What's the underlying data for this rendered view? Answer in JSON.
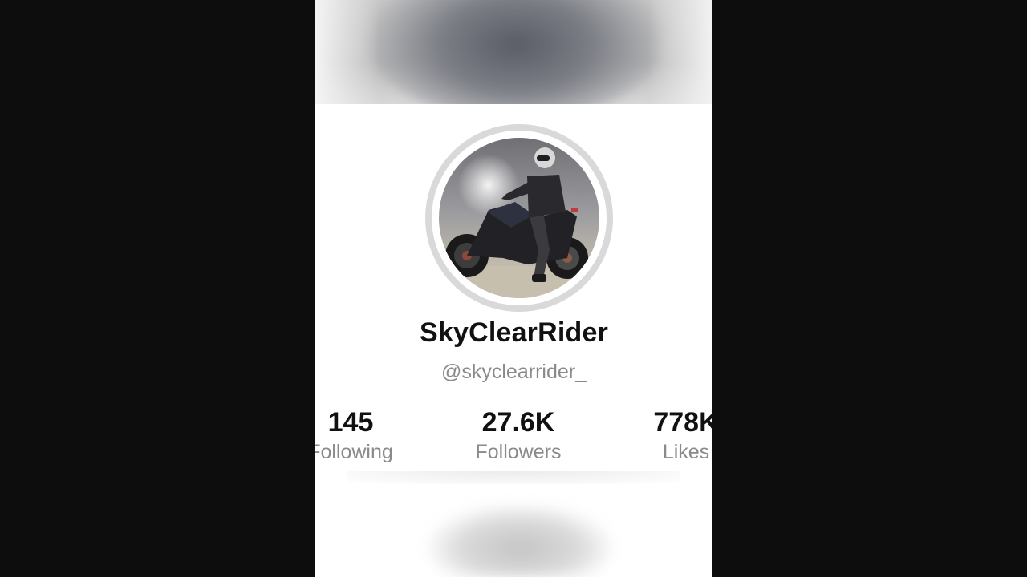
{
  "profile": {
    "display_name": "SkyClearRider",
    "handle": "@skyclearrider_"
  },
  "stats": [
    {
      "value": "145",
      "label": "Following"
    },
    {
      "value": "27.6K",
      "label": "Followers"
    },
    {
      "value": "778K",
      "label": "Likes"
    }
  ],
  "colors": {
    "background": "#0d0d0d",
    "card": "#ffffff",
    "primary_text": "#111111",
    "secondary_text": "#8a8a8a",
    "avatar_ring": "#d9d9d9"
  }
}
